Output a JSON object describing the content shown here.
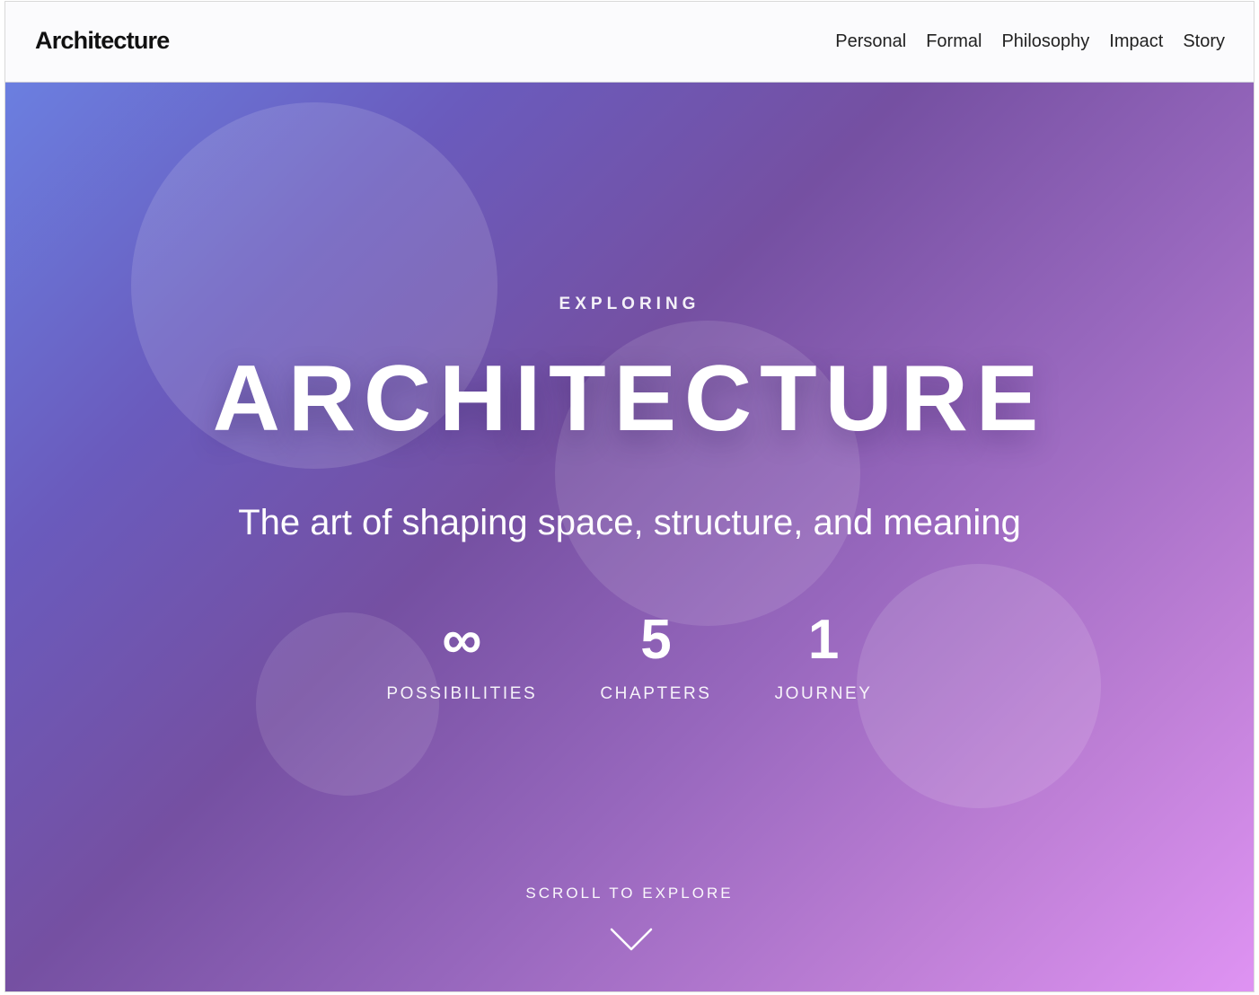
{
  "nav": {
    "brand": "Architecture",
    "links": [
      "Personal",
      "Formal",
      "Philosophy",
      "Impact",
      "Story"
    ]
  },
  "hero": {
    "eyebrow": "EXPLORING",
    "title": "ARCHITECTURE",
    "tagline": "The art of shaping space, structure, and meaning",
    "stats": [
      {
        "value": "∞",
        "label": "POSSIBILITIES"
      },
      {
        "value": "5",
        "label": "CHAPTERS"
      },
      {
        "value": "1",
        "label": "JOURNEY"
      }
    ],
    "scroll_label": "SCROLL TO EXPLORE",
    "scroll_icon": "chevron-down-icon"
  },
  "colors": {
    "gradient_start": "#6b7fe0",
    "gradient_mid": "#7550a2",
    "gradient_end": "#df93f3",
    "text": "#ffffff",
    "nav_bg": "#fbfbfd"
  }
}
